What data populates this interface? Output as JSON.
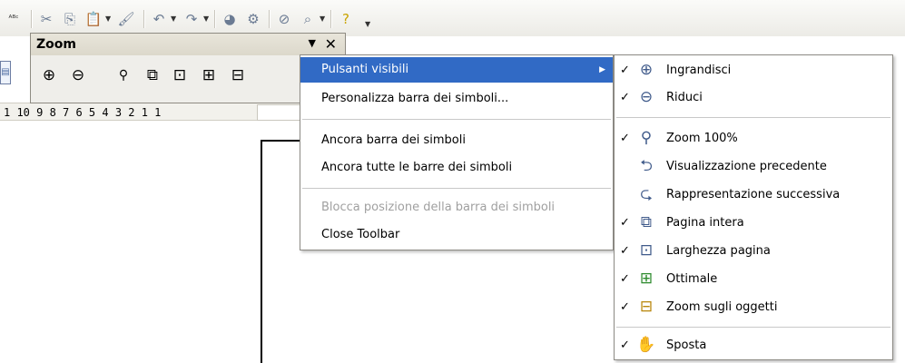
{
  "zoom_toolbar": {
    "title": "Zoom",
    "dropdown_glyph": "▼",
    "close_glyph": "✕",
    "icons": [
      "zoom-in-icon",
      "zoom-out-icon",
      "zoom-100-icon",
      "entire-page-icon",
      "page-width-icon",
      "optimal-icon",
      "zoom-objects-icon"
    ]
  },
  "ruler": {
    "text": "1 10  9  8  7  6  5  4  3  2  1        1"
  },
  "context_menu": {
    "items": [
      {
        "label": "Pulsanti visibili",
        "highlighted": true,
        "submenu": true
      },
      {
        "label": "Personalizza barra dei simboli..."
      },
      {
        "label": "Ancora barra dei simboli"
      },
      {
        "label": "Ancora tutte le barre dei simboli"
      },
      {
        "label": "Blocca posizione della barra dei simboli",
        "disabled": true
      },
      {
        "label": "Close Toolbar"
      }
    ],
    "submenu_arrow": "▶"
  },
  "submenu": {
    "check_glyph": "✓",
    "items": [
      {
        "label": "Ingrandisci",
        "checked": true,
        "icon": "zoom-in-icon"
      },
      {
        "label": "Riduci",
        "checked": true,
        "icon": "zoom-out-icon"
      },
      {
        "label": "Zoom 100%",
        "checked": true,
        "icon": "zoom-100-icon"
      },
      {
        "label": "Visualizzazione precedente",
        "checked": false,
        "icon": "previous-view-icon"
      },
      {
        "label": "Rappresentazione successiva",
        "checked": false,
        "icon": "next-view-icon"
      },
      {
        "label": "Pagina intera",
        "checked": true,
        "icon": "entire-page-icon"
      },
      {
        "label": "Larghezza pagina",
        "checked": true,
        "icon": "page-width-icon"
      },
      {
        "label": "Ottimale",
        "checked": true,
        "icon": "optimal-icon"
      },
      {
        "label": "Zoom sugli oggetti",
        "checked": true,
        "icon": "zoom-objects-icon"
      },
      {
        "label": "Sposta",
        "checked": true,
        "icon": "pan-hand-icon"
      }
    ]
  },
  "colors": {
    "highlight": "#316ac5",
    "disabled_text": "#a0a0a0"
  }
}
